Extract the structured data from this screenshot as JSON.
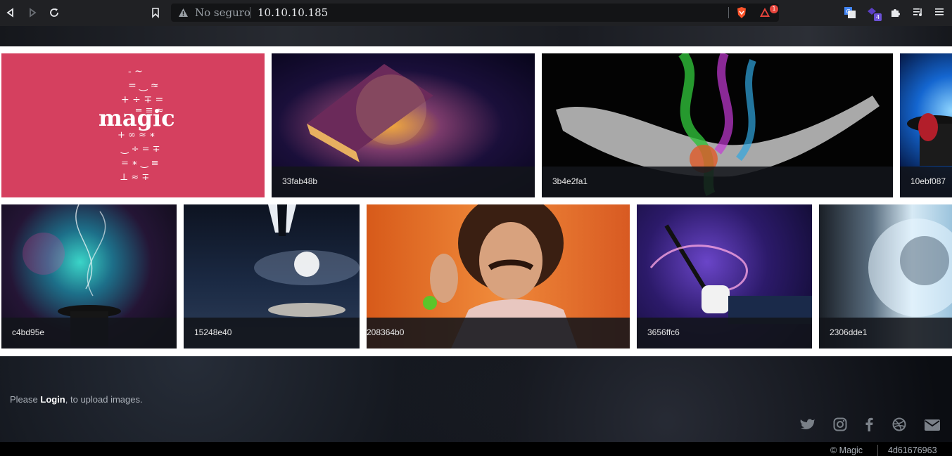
{
  "browser": {
    "security_label": "No seguro",
    "url": "10.10.10.185",
    "shields_badge": "1",
    "extension_badge": "4"
  },
  "gallery": {
    "row1": [
      {
        "caption": "",
        "logo_text": "magic"
      },
      {
        "caption": "33fab48b"
      },
      {
        "caption": "3b4e2fa1"
      },
      {
        "caption": "10ebf087"
      }
    ],
    "row2": [
      {
        "caption": "c4bd95e"
      },
      {
        "caption": "15248e40"
      },
      {
        "caption": "208364b0"
      },
      {
        "caption": "3656ffc6"
      },
      {
        "caption": "2306dde1"
      }
    ]
  },
  "footer": {
    "prefix": "Please ",
    "login_link": "Login",
    "suffix": ", to upload images.",
    "copyright": "© Magic",
    "version": "4d61676963",
    "social_icons": [
      "twitter-icon",
      "instagram-icon",
      "facebook-icon",
      "dribbble-icon",
      "email-icon"
    ]
  }
}
